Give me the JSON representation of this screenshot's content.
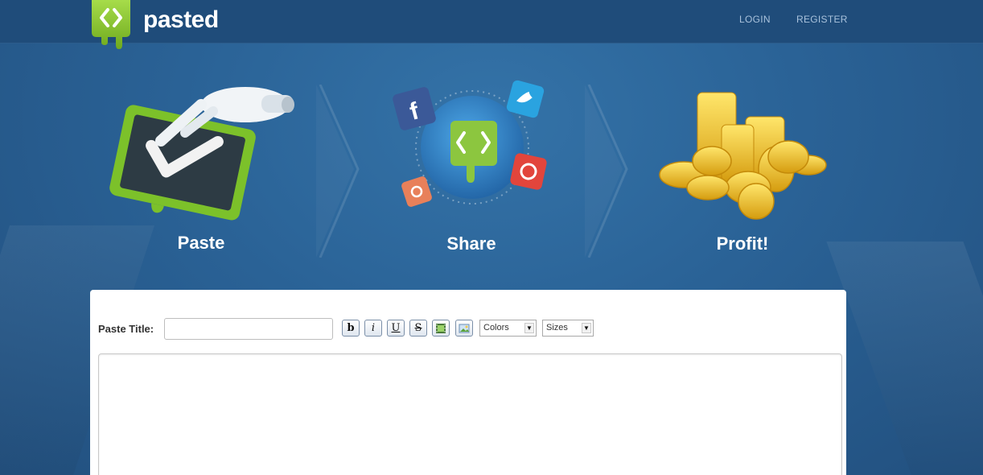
{
  "header": {
    "brand": "pasted",
    "nav": {
      "login": "LOGIN",
      "register": "REGISTER"
    }
  },
  "hero": {
    "steps": [
      {
        "label": "Paste",
        "icon": "paste-check-icon"
      },
      {
        "label": "Share",
        "icon": "share-social-icon"
      },
      {
        "label": "Profit!",
        "icon": "gold-coins-icon"
      }
    ]
  },
  "form": {
    "title_label": "Paste Title:",
    "title_value": "",
    "toolbar": {
      "bold": "b",
      "italic": "i",
      "underline": "U",
      "strike": "S",
      "colors": "Colors",
      "sizes": "Sizes"
    },
    "content_value": ""
  },
  "colors": {
    "brand_green": "#8cc63f",
    "header_bg": "#1f4c7a",
    "hero_bg": "#2a6296"
  }
}
